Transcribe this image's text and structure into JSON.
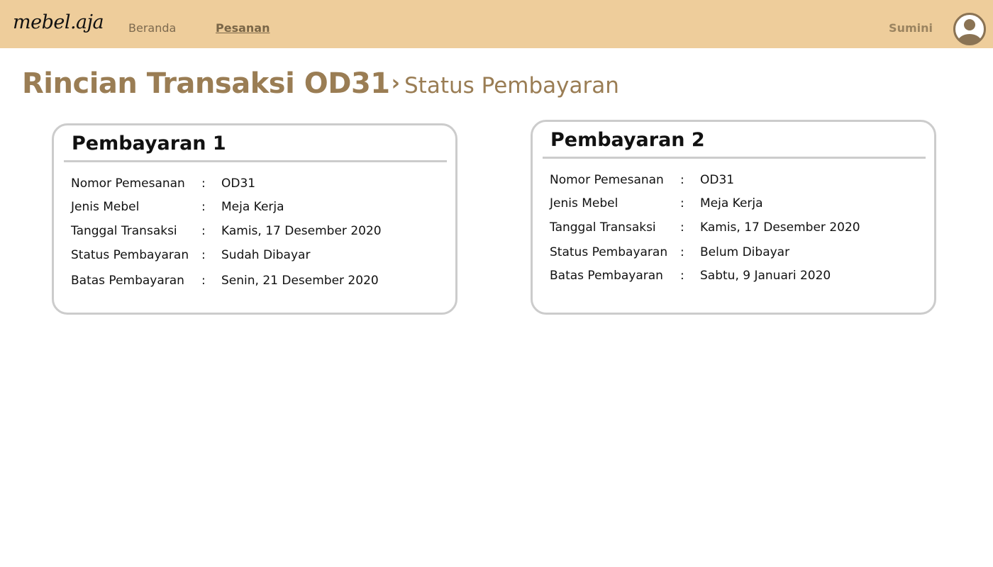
{
  "navbar": {
    "logo": "mebel.aja",
    "links": [
      {
        "label": "Beranda"
      },
      {
        "label": "Pesanan"
      }
    ],
    "username": "Sumini",
    "avatar_icon": "user-avatar-icon",
    "bg_color": "#eecd9b"
  },
  "page": {
    "title": "Rincian Transaksi OD31",
    "separator": "›",
    "subtitle": "Status Pembayaran"
  },
  "cards": [
    {
      "title": "Pembayaran 1",
      "rows": [
        {
          "label": "Nomor Pemesanan",
          "colon": ":",
          "value": "OD31"
        },
        {
          "label": "Jenis Mebel",
          "colon": ":",
          "value": "Meja Kerja"
        },
        {
          "label": "Tanggal Transaksi",
          "colon": ":",
          "value": "Kamis, 17 Desember 2020"
        },
        {
          "label": "Status Pembayaran",
          "colon": ":",
          "value": "Sudah Dibayar"
        },
        {
          "label": "Batas Pembayaran",
          "colon": ":",
          "value": "Senin, 21 Desember 2020"
        }
      ]
    },
    {
      "title": "Pembayaran 2",
      "rows": [
        {
          "label": "Nomor Pemesanan",
          "colon": ":",
          "value": "OD31"
        },
        {
          "label": "Jenis Mebel",
          "colon": ":",
          "value": "Meja Kerja"
        },
        {
          "label": "Tanggal Transaksi",
          "colon": ":",
          "value": "Kamis, 17 Desember 2020"
        },
        {
          "label": "Status Pembayaran",
          "colon": ":",
          "value": "Belum Dibayar"
        },
        {
          "label": "Batas Pembayaran",
          "colon": ":",
          "value": "Sabtu, 9 Januari 2020"
        }
      ]
    }
  ]
}
